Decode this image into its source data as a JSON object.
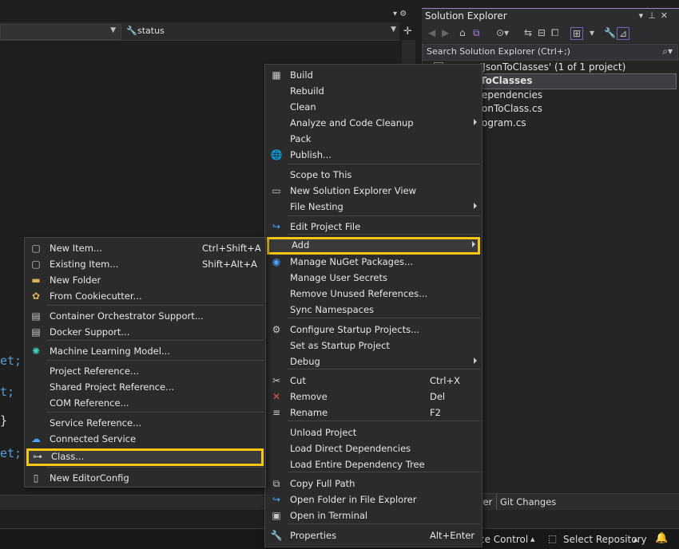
{
  "editor": {
    "status_dropdown": "status",
    "code_fragments": [
      "et;",
      "t;",
      "}",
      "et;"
    ]
  },
  "solution_explorer": {
    "title": "Solution Explorer",
    "search_placeholder": "Search Solution Explorer (Ctrl+;)",
    "tree": [
      "'JsonToClasses' (1 of 1 project)",
      "ToClasses",
      "ependencies",
      "onToClass.cs",
      "ogram.cs"
    ],
    "tabs": [
      "rer",
      "Git Changes"
    ]
  },
  "status_bar": {
    "source_control": "ce Control",
    "select_repository": "Select Repository"
  },
  "main_menu": [
    {
      "label": "Build",
      "icon": "build-icon"
    },
    {
      "label": "Rebuild"
    },
    {
      "label": "Clean"
    },
    {
      "label": "Analyze and Code Cleanup",
      "submenu": true
    },
    {
      "label": "Pack"
    },
    {
      "label": "Publish...",
      "icon": "globe-icon"
    },
    {
      "label": "Scope to This"
    },
    {
      "label": "New Solution Explorer View",
      "icon": "window-icon"
    },
    {
      "label": "File Nesting",
      "submenu": true
    },
    {
      "label": "Edit Project File",
      "icon": "refresh-arrow-icon"
    },
    {
      "label": "Add",
      "submenu": true,
      "highlighted": true
    },
    {
      "label": "Manage NuGet Packages...",
      "icon": "nuget-icon"
    },
    {
      "label": "Manage User Secrets"
    },
    {
      "label": "Remove Unused References..."
    },
    {
      "label": "Sync Namespaces"
    },
    {
      "label": "Configure Startup Projects...",
      "icon": "gear-icon"
    },
    {
      "label": "Set as Startup Project"
    },
    {
      "label": "Debug",
      "submenu": true
    },
    {
      "label": "Cut",
      "icon": "scissors-icon",
      "shortcut": "Ctrl+X"
    },
    {
      "label": "Remove",
      "icon": "close-icon",
      "shortcut": "Del"
    },
    {
      "label": "Rename",
      "icon": "rename-icon",
      "shortcut": "F2"
    },
    {
      "label": "Unload Project"
    },
    {
      "label": "Load Direct Dependencies"
    },
    {
      "label": "Load Entire Dependency Tree"
    },
    {
      "label": "Copy Full Path",
      "icon": "copy-icon"
    },
    {
      "label": "Open Folder in File Explorer",
      "icon": "folder-arrow-icon"
    },
    {
      "label": "Open in Terminal",
      "icon": "terminal-icon"
    },
    {
      "label": "Properties",
      "icon": "wrench-icon",
      "shortcut": "Alt+Enter"
    }
  ],
  "add_menu": [
    {
      "label": "New Item...",
      "icon": "new-item-icon",
      "shortcut": "Ctrl+Shift+A"
    },
    {
      "label": "Existing Item...",
      "icon": "existing-item-icon",
      "shortcut": "Shift+Alt+A"
    },
    {
      "label": "New Folder",
      "icon": "folder-icon"
    },
    {
      "label": "From Cookiecutter...",
      "icon": "cookie-icon"
    },
    {
      "label": "Container Orchestrator Support...",
      "icon": "container-icon"
    },
    {
      "label": "Docker Support...",
      "icon": "docker-icon"
    },
    {
      "label": "Machine Learning Model...",
      "icon": "ml-model-icon"
    },
    {
      "label": "Project Reference..."
    },
    {
      "label": "Shared Project Reference..."
    },
    {
      "label": "COM Reference..."
    },
    {
      "label": "Service Reference..."
    },
    {
      "label": "Connected Service",
      "icon": "cloud-service-icon"
    },
    {
      "label": "Class...",
      "icon": "class-icon",
      "highlighted": true
    },
    {
      "label": "New EditorConfig",
      "icon": "file-icon"
    }
  ],
  "colors": {
    "highlight_outline": "#f5c518",
    "menu_bg": "#2b2b2b",
    "accent": "#9d7fd6"
  }
}
